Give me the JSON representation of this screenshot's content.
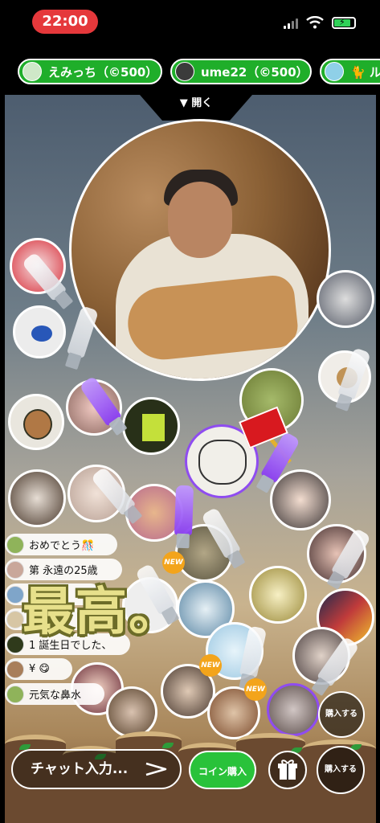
{
  "status_bar": {
    "time": "22:00"
  },
  "chips": [
    {
      "label": "えみっち（©500）"
    },
    {
      "label": "ume22（©500）"
    },
    {
      "label": "🐈 ル"
    }
  ],
  "stage": {
    "open_label": "開く"
  },
  "chat": {
    "messages": [
      {
        "text": "おめでとう🎊"
      },
      {
        "text": "第 永遠の25歳"
      },
      {
        "text": "！！！！"
      },
      {
        "text": "こん"
      },
      {
        "text": "1   誕生日でした、"
      },
      {
        "text": "¥ 😋"
      },
      {
        "text": "元気な鼻水"
      }
    ],
    "overlay_text": "最高。"
  },
  "badges": {
    "new": "NEW"
  },
  "bottom": {
    "chat_placeholder": "チャット入力...",
    "coin_button": "コイン購入",
    "buy_button": "購入する"
  },
  "colors": {
    "chip_green": "#1fae2a",
    "accent_purple": "#8f4cf0",
    "status_red": "#e5383b"
  }
}
